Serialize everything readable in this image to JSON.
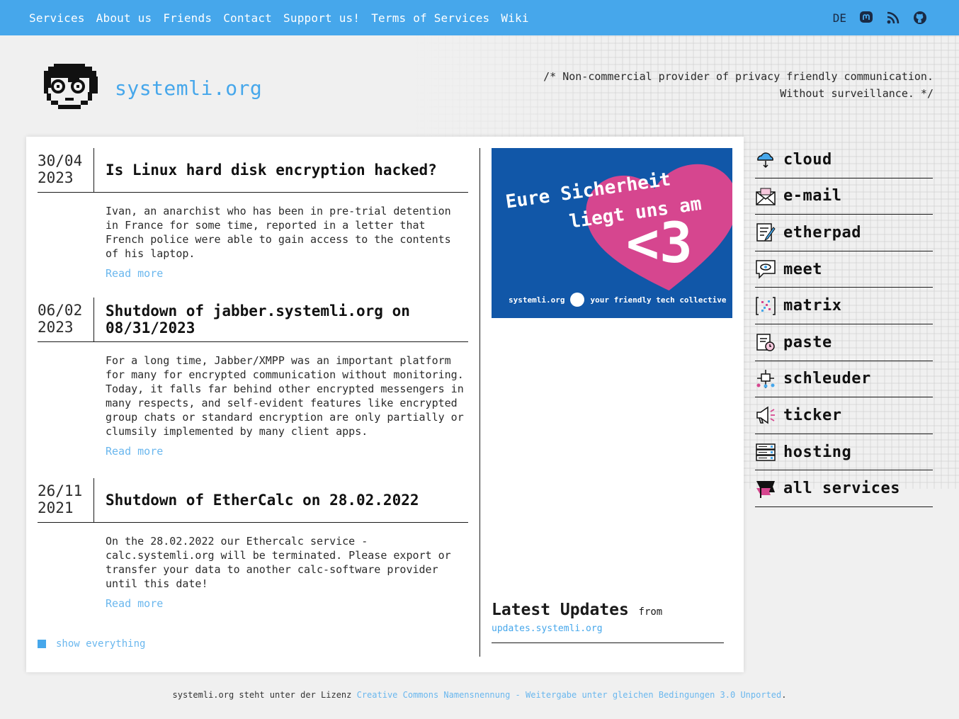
{
  "nav": {
    "items": [
      "Services",
      "About us",
      "Friends",
      "Contact",
      "Support us!",
      "Terms of Services",
      "Wiki"
    ],
    "lang": "DE",
    "icons": [
      "mastodon-icon",
      "rss-icon",
      "github-icon"
    ]
  },
  "header": {
    "site_name": "systemli.org",
    "tagline": "/* Non-commercial provider of privacy friendly communication. Without surveillance. */"
  },
  "posts": [
    {
      "date_line1": "30/04",
      "date_line2": "2023",
      "title": "Is Linux hard disk encryption hacked?",
      "body": "Ivan, an anarchist who has been in pre-trial detention in France for some time, reported in a letter that French police were able to gain access to the contents of his laptop.",
      "read_more": "Read more"
    },
    {
      "date_line1": "06/02",
      "date_line2": "2023",
      "title": "Shutdown of jabber.systemli.org on 08/31/2023",
      "body": "For a long time, Jabber/XMPP was an important platform for many for encrypted communication without monitoring. Today, it falls far behind other encrypted messengers in many respects, and self-evident features like encrypted group chats or standard encryption are only partially or clumsily implemented by many client apps.",
      "read_more": "Read more"
    },
    {
      "date_line1": "26/11",
      "date_line2": "2021",
      "title": "Shutdown of EtherCalc on 28.02.2022",
      "body": "On the 28.02.2022 our Ethercalc service - calc.systemli.org will be terminated. Please export or transfer your data to another calc-software provider until this date!",
      "read_more": "Read more"
    }
  ],
  "show_all": "show everything",
  "banner": {
    "line1": "Eure Sicherheit",
    "line2": "liegt uns am",
    "big": "<3",
    "foot_left": "systemli.org",
    "foot_right": "your friendly tech collective",
    "colors": {
      "bg": "#1157a8",
      "heart": "#d6468f"
    }
  },
  "updates": {
    "title": "Latest Updates",
    "from": "from",
    "link": "updates.systemli.org"
  },
  "services": [
    {
      "label": "cloud",
      "icon": "cloud-icon"
    },
    {
      "label": "e-mail",
      "icon": "mail-icon"
    },
    {
      "label": "etherpad",
      "icon": "pad-icon"
    },
    {
      "label": "meet",
      "icon": "meet-icon"
    },
    {
      "label": "matrix",
      "icon": "matrix-icon"
    },
    {
      "label": "paste",
      "icon": "paste-icon"
    },
    {
      "label": "schleuder",
      "icon": "schleuder-icon"
    },
    {
      "label": "ticker",
      "icon": "ticker-icon"
    },
    {
      "label": "hosting",
      "icon": "hosting-icon"
    },
    {
      "label": "all services",
      "icon": "flag-icon"
    }
  ],
  "footer": {
    "text": "systemli.org steht unter der Lizenz ",
    "link": "Creative Commons Namensnennung - Weitergabe unter gleichen Bedingungen 3.0 Unported",
    "end": "."
  },
  "colors": {
    "accent": "#46a7eb",
    "link": "#6ab7ee"
  }
}
